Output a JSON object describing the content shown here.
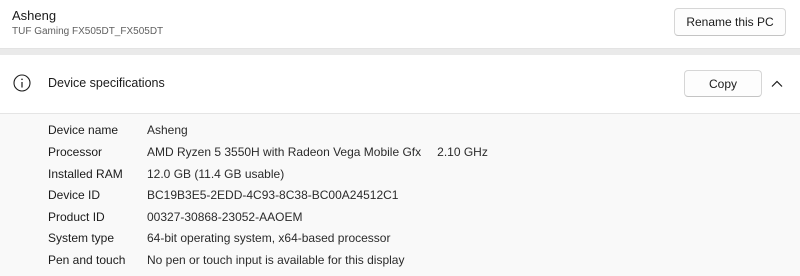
{
  "pc": {
    "name": "Asheng",
    "model": "TUF Gaming FX505DT_FX505DT",
    "rename_label": "Rename this PC"
  },
  "device_specs": {
    "title": "Device specifications",
    "copy_label": "Copy",
    "icons": {
      "info": "info-circle-icon",
      "collapse": "chevron-up-icon"
    },
    "rows": [
      {
        "label": "Device name",
        "value": "Asheng"
      },
      {
        "label": "Processor",
        "value": "AMD Ryzen 5 3550H with Radeon Vega Mobile Gfx",
        "extra": "2.10 GHz"
      },
      {
        "label": "Installed RAM",
        "value": "12.0 GB (11.4 GB usable)"
      },
      {
        "label": "Device ID",
        "value": "BC19B3E5-2EDD-4C93-8C38-BC00A24512C1"
      },
      {
        "label": "Product ID",
        "value": "00327-30868-23052-AAOEM"
      },
      {
        "label": "System type",
        "value": "64-bit operating system, x64-based processor"
      },
      {
        "label": "Pen and touch",
        "value": "No pen or touch input is available for this display"
      }
    ]
  }
}
